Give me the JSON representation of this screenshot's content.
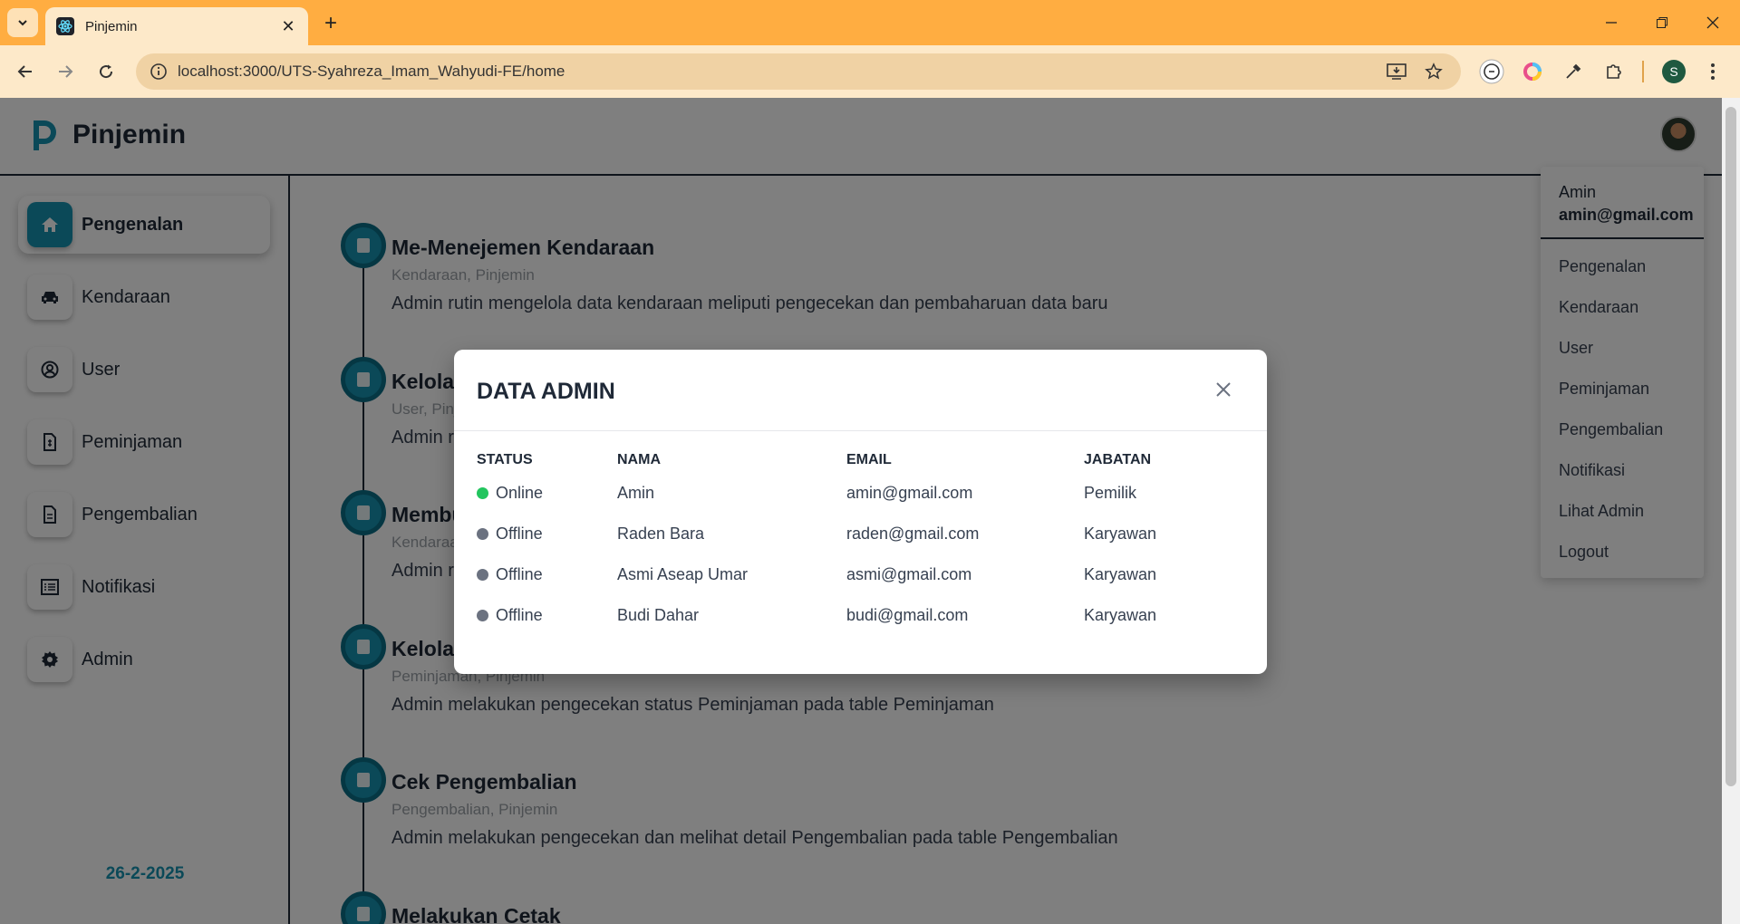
{
  "browser": {
    "tab_title": "Pinjemin",
    "url": "localhost:3000/UTS-Syahreza_Imam_Wahyudi-FE/home",
    "profile_initial": "S"
  },
  "app": {
    "brand": "Pinjemin",
    "date": "26-2-2025"
  },
  "sidebar": {
    "items": [
      {
        "label": "Pengenalan",
        "icon": "home-icon"
      },
      {
        "label": "Kendaraan",
        "icon": "car-icon"
      },
      {
        "label": "User",
        "icon": "user-circle-icon"
      },
      {
        "label": "Peminjaman",
        "icon": "document-dollar-icon"
      },
      {
        "label": "Pengembalian",
        "icon": "document-icon"
      },
      {
        "label": "Notifikasi",
        "icon": "list-icon"
      },
      {
        "label": "Admin",
        "icon": "gear-icon"
      }
    ]
  },
  "timeline": [
    {
      "title": "Me-Menejemen Kendaraan",
      "tags": "Kendaraan, Pinjemin",
      "desc": "Admin rutin mengelola data kendaraan meliputi pengecekan dan pembaharuan data baru"
    },
    {
      "title": "Kelola",
      "tags": "User, Pinj",
      "desc": "Admin r"
    },
    {
      "title": "Membu",
      "tags": "Kendaraa",
      "desc": "Admin r"
    },
    {
      "title": "Kelola",
      "tags": "Peminjaman, Pinjemin",
      "desc": "Admin melakukan pengecekan status Peminjaman pada table Peminjaman"
    },
    {
      "title": "Cek Pengembalian",
      "tags": "Pengembalian, Pinjemin",
      "desc": "Admin melakukan pengecekan dan melihat detail Pengembalian pada table Pengembalian"
    },
    {
      "title": "Melakukan Cetak",
      "tags": "",
      "desc": ""
    }
  ],
  "user_menu": {
    "name": "Amin",
    "email": "amin@gmail.com",
    "items": [
      "Pengenalan",
      "Kendaraan",
      "User",
      "Peminjaman",
      "Pengembalian",
      "Notifikasi",
      "Lihat Admin",
      "Logout"
    ]
  },
  "modal": {
    "title": "DATA ADMIN",
    "columns": [
      "STATUS",
      "NAMA",
      "EMAIL",
      "JABATAN"
    ],
    "rows": [
      {
        "status": "Online",
        "nama": "Amin",
        "email": "amin@gmail.com",
        "jabatan": "Pemilik"
      },
      {
        "status": "Offline",
        "nama": "Raden Bara",
        "email": "raden@gmail.com",
        "jabatan": "Karyawan"
      },
      {
        "status": "Offline",
        "nama": "Asmi Aseap Umar",
        "email": "asmi@gmail.com",
        "jabatan": "Karyawan"
      },
      {
        "status": "Offline",
        "nama": "Budi Dahar",
        "email": "budi@gmail.com",
        "jabatan": "Karyawan"
      }
    ]
  },
  "colors": {
    "browser_frame": "#ffad41",
    "accent": "#1693b0",
    "online": "#22c55e",
    "offline": "#6b7280"
  }
}
